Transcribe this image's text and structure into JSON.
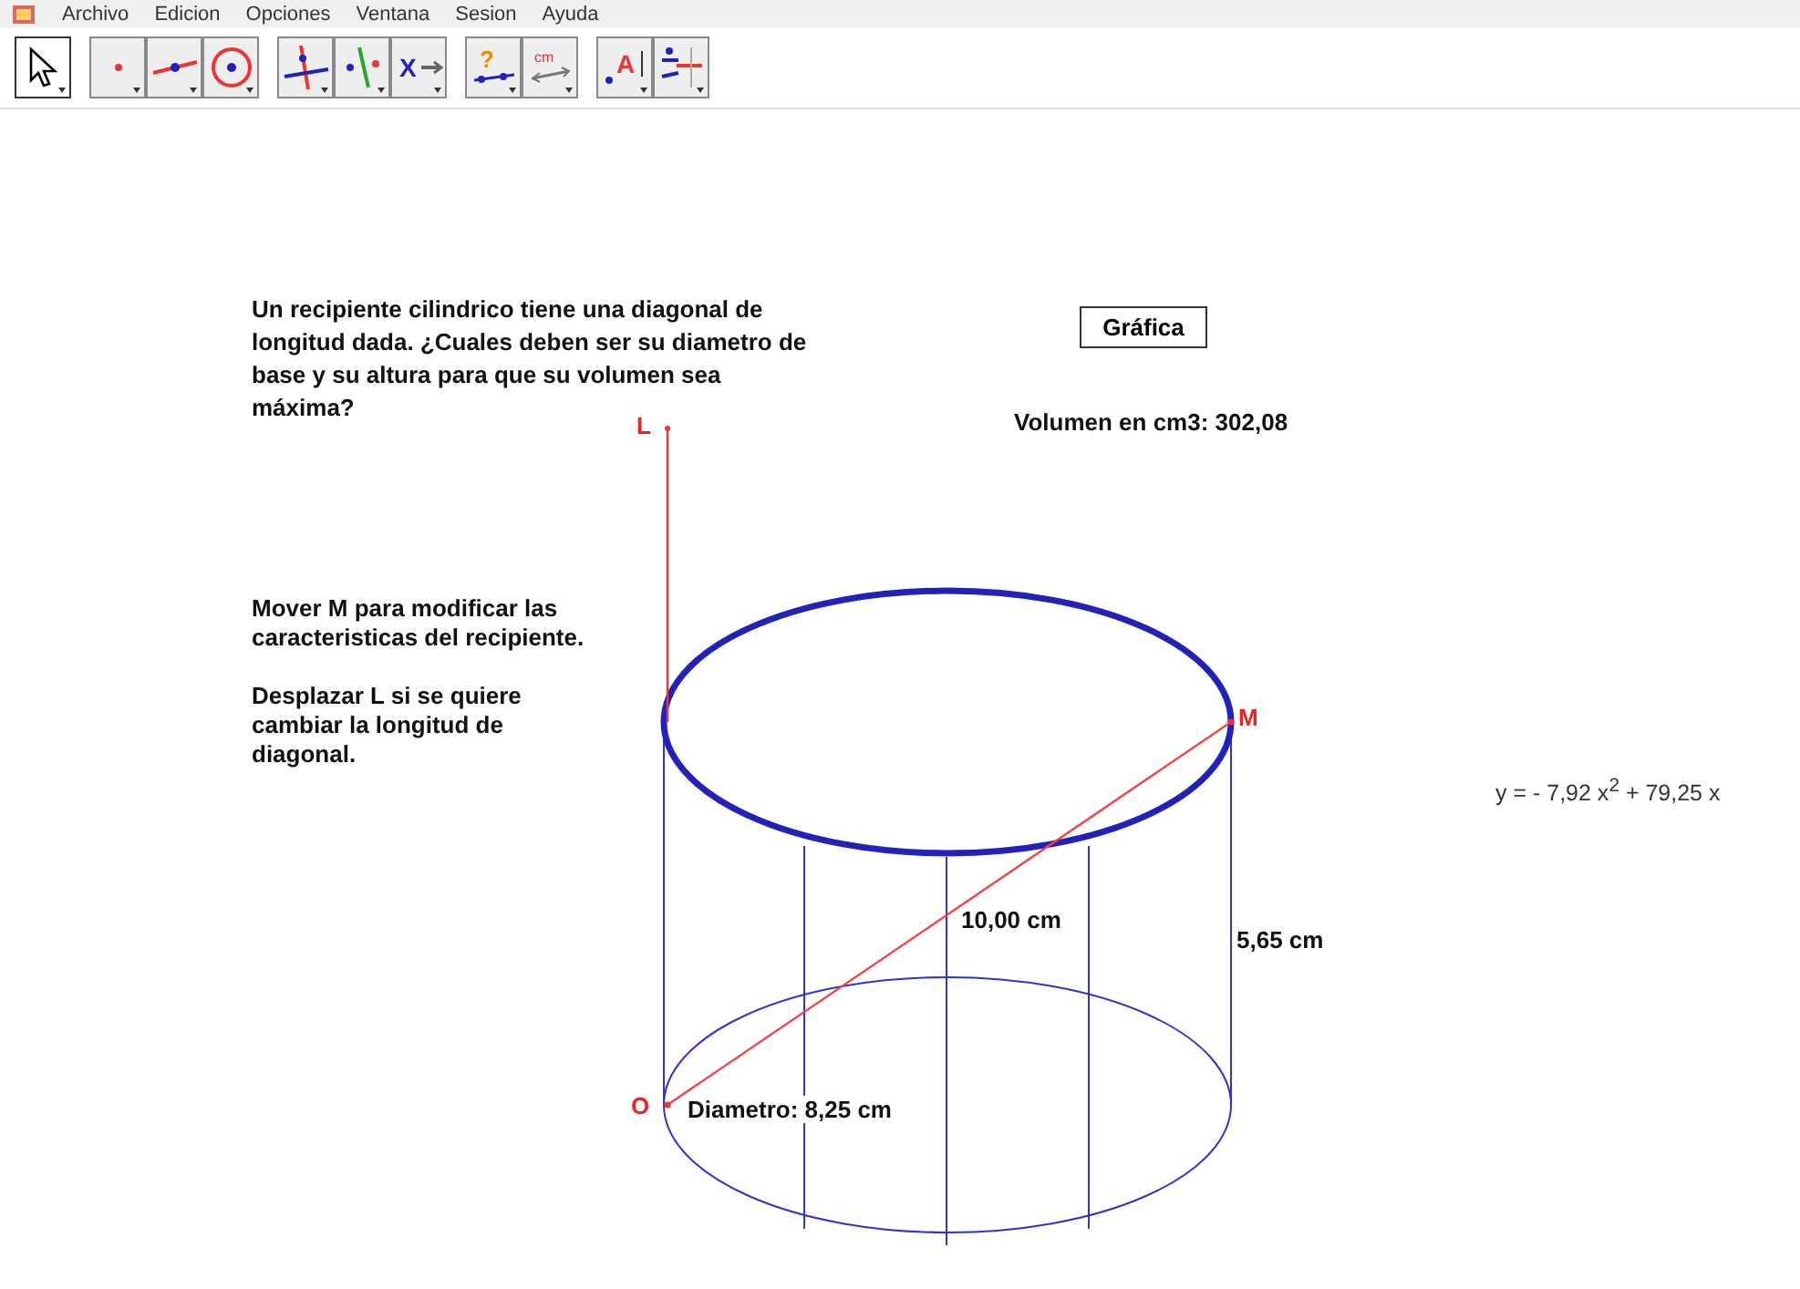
{
  "menu": [
    "Archivo",
    "Edicion",
    "Opciones",
    "Ventana",
    "Sesion",
    "Ayuda"
  ],
  "toolbar": [
    [
      {
        "kind": "pointer",
        "selected": true
      }
    ],
    [
      {
        "kind": "point",
        "selected": false
      },
      {
        "kind": "line",
        "selected": false
      },
      {
        "kind": "circle",
        "selected": false
      }
    ],
    [
      {
        "kind": "perpendicular",
        "selected": false
      },
      {
        "kind": "reflect",
        "selected": false
      },
      {
        "kind": "translate",
        "label": "X",
        "selected": false
      }
    ],
    [
      {
        "kind": "query",
        "label": "?",
        "selected": false
      },
      {
        "kind": "distance",
        "label": "cm",
        "selected": false
      }
    ],
    [
      {
        "kind": "text",
        "label": "A",
        "selected": false
      },
      {
        "kind": "midpoint",
        "selected": false
      }
    ]
  ],
  "question": "Un recipiente cilindrico tiene una diagonal de longitud dada. ¿Cuales deben ser su diametro de base y su altura para que su volumen sea máxima?",
  "graph_button": "Gráfica",
  "volume": "Volumen en cm3: 302,08",
  "instructions": [
    "Mover M para modificar las caracteristicas del recipiente.",
    "Desplazar L si se quiere cambiar la longitud de diagonal."
  ],
  "equation": "y =  - 7,92 x$^{2}$ + 79,25 x",
  "points": {
    "L": "L",
    "M": "M",
    "O": "O"
  },
  "measures": {
    "diagonal": "10,00 cm",
    "height": "5,65 cm",
    "diameter": "Diametro: 8,25 cm"
  }
}
